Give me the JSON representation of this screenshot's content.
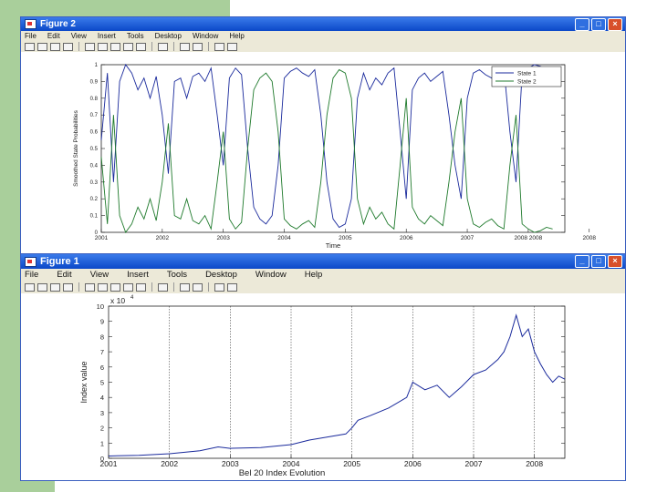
{
  "slide": {
    "accent_green": "#a9cf9b"
  },
  "figure2": {
    "title": "Figure 2",
    "menu": [
      "File",
      "Edit",
      "View",
      "Insert",
      "Tools",
      "Desktop",
      "Window",
      "Help"
    ],
    "chart_data": {
      "type": "line",
      "xlabel": "Time",
      "ylabel": "Smoothed State Probabilities",
      "ylim": [
        0,
        1
      ],
      "yticks": [
        "0",
        "0.1",
        "0.2",
        "0.3",
        "0.4",
        "0.5",
        "0.6",
        "0.7",
        "0.8",
        "0.9",
        "1"
      ],
      "x_tick_labels": [
        "2001",
        "2002",
        "2003",
        "2004",
        "2005",
        "2006",
        "2007",
        "2008 2008",
        "2008"
      ],
      "legend_position": "top-right",
      "series": [
        {
          "name": "State 1",
          "color": "#1a2a9c",
          "x": [
            2001.0,
            2001.1,
            2001.2,
            2001.3,
            2001.4,
            2001.5,
            2001.6,
            2001.7,
            2001.8,
            2001.9,
            2002.0,
            2002.1,
            2002.2,
            2002.3,
            2002.4,
            2002.5,
            2002.6,
            2002.7,
            2002.8,
            2002.9,
            2003.0,
            2003.1,
            2003.2,
            2003.3,
            2003.4,
            2003.5,
            2003.6,
            2003.7,
            2003.8,
            2003.9,
            2004.0,
            2004.1,
            2004.2,
            2004.3,
            2004.4,
            2004.5,
            2004.6,
            2004.7,
            2004.8,
            2004.9,
            2005.0,
            2005.1,
            2005.2,
            2005.3,
            2005.4,
            2005.5,
            2005.6,
            2005.7,
            2005.8,
            2005.9,
            2006.0,
            2006.1,
            2006.2,
            2006.3,
            2006.4,
            2006.5,
            2006.6,
            2006.7,
            2006.8,
            2006.9,
            2007.0,
            2007.1,
            2007.2,
            2007.3,
            2007.4,
            2007.5,
            2007.6,
            2007.7,
            2007.8,
            2007.9,
            2008.0,
            2008.1,
            2008.2,
            2008.3,
            2008.4
          ],
          "values": [
            0.55,
            0.95,
            0.3,
            0.9,
            1.0,
            0.95,
            0.85,
            0.92,
            0.8,
            0.93,
            0.7,
            0.35,
            0.9,
            0.92,
            0.8,
            0.93,
            0.95,
            0.9,
            0.98,
            0.7,
            0.4,
            0.92,
            0.98,
            0.94,
            0.5,
            0.15,
            0.08,
            0.05,
            0.1,
            0.4,
            0.92,
            0.96,
            0.98,
            0.95,
            0.93,
            0.97,
            0.7,
            0.3,
            0.08,
            0.03,
            0.05,
            0.2,
            0.8,
            0.95,
            0.85,
            0.92,
            0.88,
            0.95,
            0.98,
            0.6,
            0.2,
            0.85,
            0.92,
            0.95,
            0.9,
            0.93,
            0.96,
            0.7,
            0.4,
            0.2,
            0.8,
            0.95,
            0.97,
            0.94,
            0.92,
            0.96,
            0.98,
            0.6,
            0.3,
            0.95,
            0.98,
            1.0,
            0.99,
            0.97,
            0.98
          ]
        },
        {
          "name": "State 2",
          "color": "#1f7a2c",
          "x": [
            2001.0,
            2001.1,
            2001.2,
            2001.3,
            2001.4,
            2001.5,
            2001.6,
            2001.7,
            2001.8,
            2001.9,
            2002.0,
            2002.1,
            2002.2,
            2002.3,
            2002.4,
            2002.5,
            2002.6,
            2002.7,
            2002.8,
            2002.9,
            2003.0,
            2003.1,
            2003.2,
            2003.3,
            2003.4,
            2003.5,
            2003.6,
            2003.7,
            2003.8,
            2003.9,
            2004.0,
            2004.1,
            2004.2,
            2004.3,
            2004.4,
            2004.5,
            2004.6,
            2004.7,
            2004.8,
            2004.9,
            2005.0,
            2005.1,
            2005.2,
            2005.3,
            2005.4,
            2005.5,
            2005.6,
            2005.7,
            2005.8,
            2005.9,
            2006.0,
            2006.1,
            2006.2,
            2006.3,
            2006.4,
            2006.5,
            2006.6,
            2006.7,
            2006.8,
            2006.9,
            2007.0,
            2007.1,
            2007.2,
            2007.3,
            2007.4,
            2007.5,
            2007.6,
            2007.7,
            2007.8,
            2007.9,
            2008.0,
            2008.1,
            2008.2,
            2008.3,
            2008.4
          ],
          "values": [
            0.45,
            0.05,
            0.7,
            0.1,
            0.0,
            0.05,
            0.15,
            0.08,
            0.2,
            0.07,
            0.3,
            0.65,
            0.1,
            0.08,
            0.2,
            0.07,
            0.05,
            0.1,
            0.02,
            0.3,
            0.6,
            0.08,
            0.02,
            0.06,
            0.5,
            0.85,
            0.92,
            0.95,
            0.9,
            0.6,
            0.08,
            0.04,
            0.02,
            0.05,
            0.07,
            0.03,
            0.3,
            0.7,
            0.92,
            0.97,
            0.95,
            0.8,
            0.2,
            0.05,
            0.15,
            0.08,
            0.12,
            0.05,
            0.02,
            0.4,
            0.8,
            0.15,
            0.08,
            0.05,
            0.1,
            0.07,
            0.04,
            0.3,
            0.6,
            0.8,
            0.2,
            0.05,
            0.03,
            0.06,
            0.08,
            0.04,
            0.02,
            0.4,
            0.7,
            0.05,
            0.02,
            0.0,
            0.01,
            0.03,
            0.02
          ]
        }
      ]
    }
  },
  "figure1": {
    "title": "Figure 1",
    "menu": [
      "File",
      "Edit",
      "View",
      "Insert",
      "Tools",
      "Desktop",
      "Window",
      "Help"
    ],
    "chart_data": {
      "type": "line",
      "xlabel": "Bel 20 Index Evolution",
      "ylabel": "Index value",
      "scale_note": "x 10",
      "scale_exp": "4",
      "ylim": [
        0,
        10
      ],
      "yticks": [
        "0",
        "1",
        "2",
        "3",
        "4",
        "5",
        "6",
        "7",
        "8",
        "9",
        "10"
      ],
      "xlim": [
        2001,
        2008.5
      ],
      "x_tick_labels": [
        "2001",
        "2002",
        "2003",
        "2004",
        "2005",
        "2006",
        "2007",
        "2008"
      ],
      "grid_x": true,
      "series": [
        {
          "name": "",
          "color": "#1a2a9c",
          "x": [
            2001.0,
            2001.5,
            2002.0,
            2002.5,
            2002.8,
            2003.0,
            2003.5,
            2004.0,
            2004.3,
            2004.6,
            2004.9,
            2005.0,
            2005.1,
            2005.3,
            2005.6,
            2005.9,
            2006.0,
            2006.2,
            2006.4,
            2006.6,
            2006.8,
            2007.0,
            2007.2,
            2007.4,
            2007.5,
            2007.6,
            2007.7,
            2007.8,
            2007.9,
            2008.0,
            2008.1,
            2008.2,
            2008.3,
            2008.4,
            2008.5
          ],
          "values": [
            0.15,
            0.2,
            0.3,
            0.5,
            0.75,
            0.65,
            0.7,
            0.9,
            1.2,
            1.4,
            1.6,
            2.0,
            2.5,
            2.8,
            3.3,
            4.0,
            5.0,
            4.5,
            4.8,
            4.0,
            4.7,
            5.5,
            5.8,
            6.5,
            7.0,
            8.0,
            9.4,
            8.0,
            8.5,
            7.0,
            6.2,
            5.5,
            5.0,
            5.4,
            5.2
          ]
        }
      ]
    }
  }
}
